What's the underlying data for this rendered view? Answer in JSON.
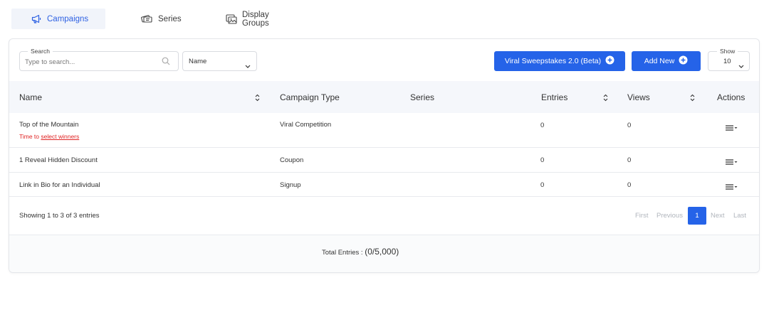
{
  "tabs": {
    "campaigns": "Campaigns",
    "series": "Series",
    "display_groups": "Display Groups"
  },
  "toolbar": {
    "search_legend": "Search",
    "search_placeholder": "Type to search...",
    "filter_value": "Name",
    "viral_button": "Viral Sweepstakes 2.0 (Beta)",
    "add_button": "Add New",
    "show_legend": "Show",
    "show_value": "10"
  },
  "columns": [
    "Name",
    "Campaign Type",
    "Series",
    "Entries",
    "Views",
    "Actions"
  ],
  "rows": [
    {
      "name": "Top of the Mountain",
      "type": "Viral Competition",
      "series": "",
      "entries": "0",
      "views": "0",
      "warning_prefix": "Time to ",
      "warning_link": "select winners"
    },
    {
      "name": "1 Reveal Hidden Discount",
      "type": "Coupon",
      "series": "",
      "entries": "0",
      "views": "0"
    },
    {
      "name": "Link in Bio for an Individual",
      "type": "Signup",
      "series": "",
      "entries": "0",
      "views": "0"
    }
  ],
  "pagination": {
    "summary": "Showing 1 to 3 of 3 entries",
    "first": "First",
    "previous": "Previous",
    "current": "1",
    "next": "Next",
    "last": "Last"
  },
  "totals": {
    "label": "Total Entries :",
    "value": "(0/5,000)"
  },
  "colors": {
    "accent": "#2563e8",
    "warning": "#e02424",
    "active_tab_bg": "#f1f4fa"
  }
}
